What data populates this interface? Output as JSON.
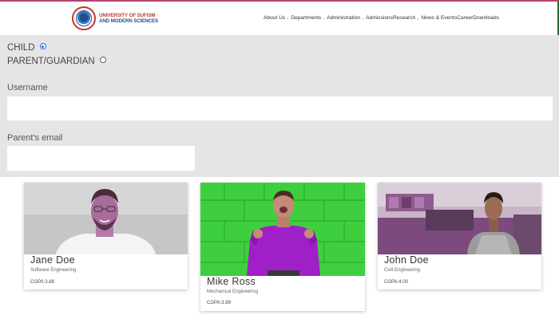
{
  "header": {
    "logo_line1": "University of Sufism",
    "logo_line2": "and Modern Sciences",
    "nav": [
      {
        "label": "About Us",
        "caret": true
      },
      {
        "label": "Departments",
        "caret": true
      },
      {
        "label": "Administration",
        "caret": true
      },
      {
        "label": "Admissions",
        "caret": false
      },
      {
        "label": "Research",
        "caret": true
      },
      {
        "label": "News & Events",
        "caret": false
      },
      {
        "label": "Career",
        "caret": false
      },
      {
        "label": "Downloads",
        "caret": false
      }
    ]
  },
  "form": {
    "radio_child": {
      "label": "CHILD",
      "checked": true
    },
    "radio_parent": {
      "label": "PARENT/GUARDIAN",
      "checked": false
    },
    "username_label": "Username",
    "username_value": "",
    "email_label": "Parent's email",
    "email_value": ""
  },
  "cards": [
    {
      "name": "Jane Doe",
      "department": "Software Engineering",
      "cgpa": "CGPA:3.88"
    },
    {
      "name": "Mike Ross",
      "department": "Mechanical Engineering",
      "cgpa": "CGPA:3.99"
    },
    {
      "name": "John Doe",
      "department": "Civil Engineering",
      "cgpa": "CGPA:4.00"
    }
  ],
  "colors": {
    "accent_top": "#b2456e",
    "form_bg": "#e5e5e5",
    "logo_red": "#c0392b",
    "logo_blue": "#1f4e8c",
    "card2_bg": "#3ecf3e",
    "shirt_purple": "#a020c8"
  }
}
